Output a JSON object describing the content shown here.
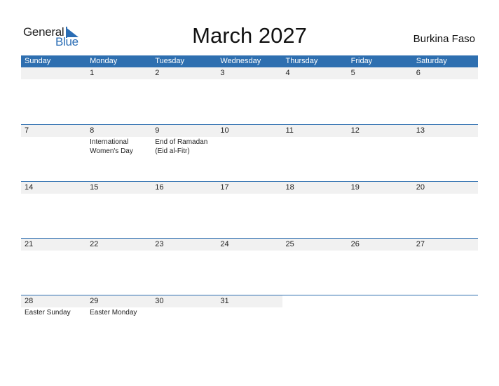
{
  "logo": {
    "word1": "General",
    "word2": "Blue"
  },
  "title": "March 2027",
  "country": "Burkina Faso",
  "colors": {
    "accent": "#2e6fb0",
    "row_bg": "#f1f1f1"
  },
  "weekdays": [
    "Sunday",
    "Monday",
    "Tuesday",
    "Wednesday",
    "Thursday",
    "Friday",
    "Saturday"
  ],
  "weeks": [
    {
      "days": [
        "",
        "1",
        "2",
        "3",
        "4",
        "5",
        "6"
      ],
      "holidays": [
        "",
        "",
        "",
        "",
        "",
        "",
        ""
      ]
    },
    {
      "days": [
        "7",
        "8",
        "9",
        "10",
        "11",
        "12",
        "13"
      ],
      "holidays": [
        "",
        "International Women's Day",
        "End of Ramadan (Eid al-Fitr)",
        "",
        "",
        "",
        ""
      ]
    },
    {
      "days": [
        "14",
        "15",
        "16",
        "17",
        "18",
        "19",
        "20"
      ],
      "holidays": [
        "",
        "",
        "",
        "",
        "",
        "",
        ""
      ]
    },
    {
      "days": [
        "21",
        "22",
        "23",
        "24",
        "25",
        "26",
        "27"
      ],
      "holidays": [
        "",
        "",
        "",
        "",
        "",
        "",
        ""
      ]
    },
    {
      "days": [
        "28",
        "29",
        "30",
        "31",
        "",
        "",
        ""
      ],
      "holidays": [
        "Easter Sunday",
        "Easter Monday",
        "",
        "",
        "",
        "",
        ""
      ]
    }
  ]
}
